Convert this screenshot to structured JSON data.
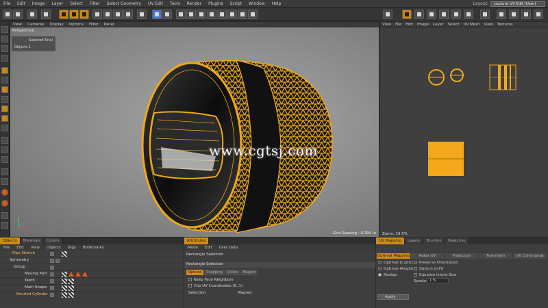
{
  "menubar": {
    "items": [
      "File",
      "Edit",
      "Image",
      "Layer",
      "Select",
      "Filter",
      "Select Geometry",
      "UV Edit",
      "Tools",
      "Render",
      "Plugins",
      "Script",
      "Window",
      "Help"
    ],
    "layout_label": "Layout:",
    "layout_value": "capture UV Edit (User)"
  },
  "viewport": {
    "menu": [
      "View",
      "Cameras",
      "Display",
      "Options",
      "Filter",
      "Panel"
    ],
    "label": "Perspective",
    "sel_header": "Selected Total",
    "sel_row": "Objects  1",
    "grid_spacing": "Grid Spacing : 0.394 in",
    "watermark": "www.cgtsj.com"
  },
  "uv_editor": {
    "menu": [
      "View",
      "File",
      "Edit",
      "Image",
      "Layer",
      "Select",
      "UV Mesh",
      "View",
      "Textures"
    ],
    "zoom": "Zoom: 19.5%"
  },
  "objects_panel": {
    "tabs": [
      "Objects",
      "Materials",
      "Coloris"
    ],
    "menu": [
      "File",
      "Edit",
      "View",
      "Objects",
      "Tags",
      "Bookmarks"
    ],
    "rows": [
      {
        "name": "Pipe Stretch"
      },
      {
        "name": "Symmetry"
      },
      {
        "name": "Group"
      },
      {
        "name": "Moving Part"
      },
      {
        "name": "Teeth"
      },
      {
        "name": "Main Shape"
      },
      {
        "name": "Knurled Cylinder"
      }
    ]
  },
  "attributes": {
    "tabs": [
      "Attributes"
    ],
    "menu": [
      "Mode",
      "Edit",
      "User Data"
    ],
    "title": "Rectangle Selection",
    "subheader": "Rectangle Selection",
    "subtabs": [
      "Options",
      "Snapping",
      "Colors",
      "Magnet"
    ],
    "options": [
      "Keep Face Neighbors",
      "Clip UV Coordinates (0..1)"
    ],
    "section_selection": "Selection",
    "section_magnet": "Magnet"
  },
  "uv_mapping": {
    "tabs": [
      "UV Mapping",
      "Layers",
      "Brushes",
      "Swatches"
    ],
    "subtabs": [
      "Optimal Mapping",
      "Relax UV",
      "Projection",
      "Transform",
      "UV Commands"
    ],
    "radios": [
      "Optimal (Cubic)",
      "Optimal (Angle)",
      "Realign"
    ],
    "checks": [
      "Preserve Orientation",
      "Stretch to Fit",
      "Equalize Island Size"
    ],
    "spacing_label": "Spacing",
    "spacing_value": "1 %",
    "apply_label": "Apply"
  },
  "colors": {
    "accent": "#d08a1a",
    "mesh": "#f0a818",
    "uv_fill": "#f5a81c"
  }
}
